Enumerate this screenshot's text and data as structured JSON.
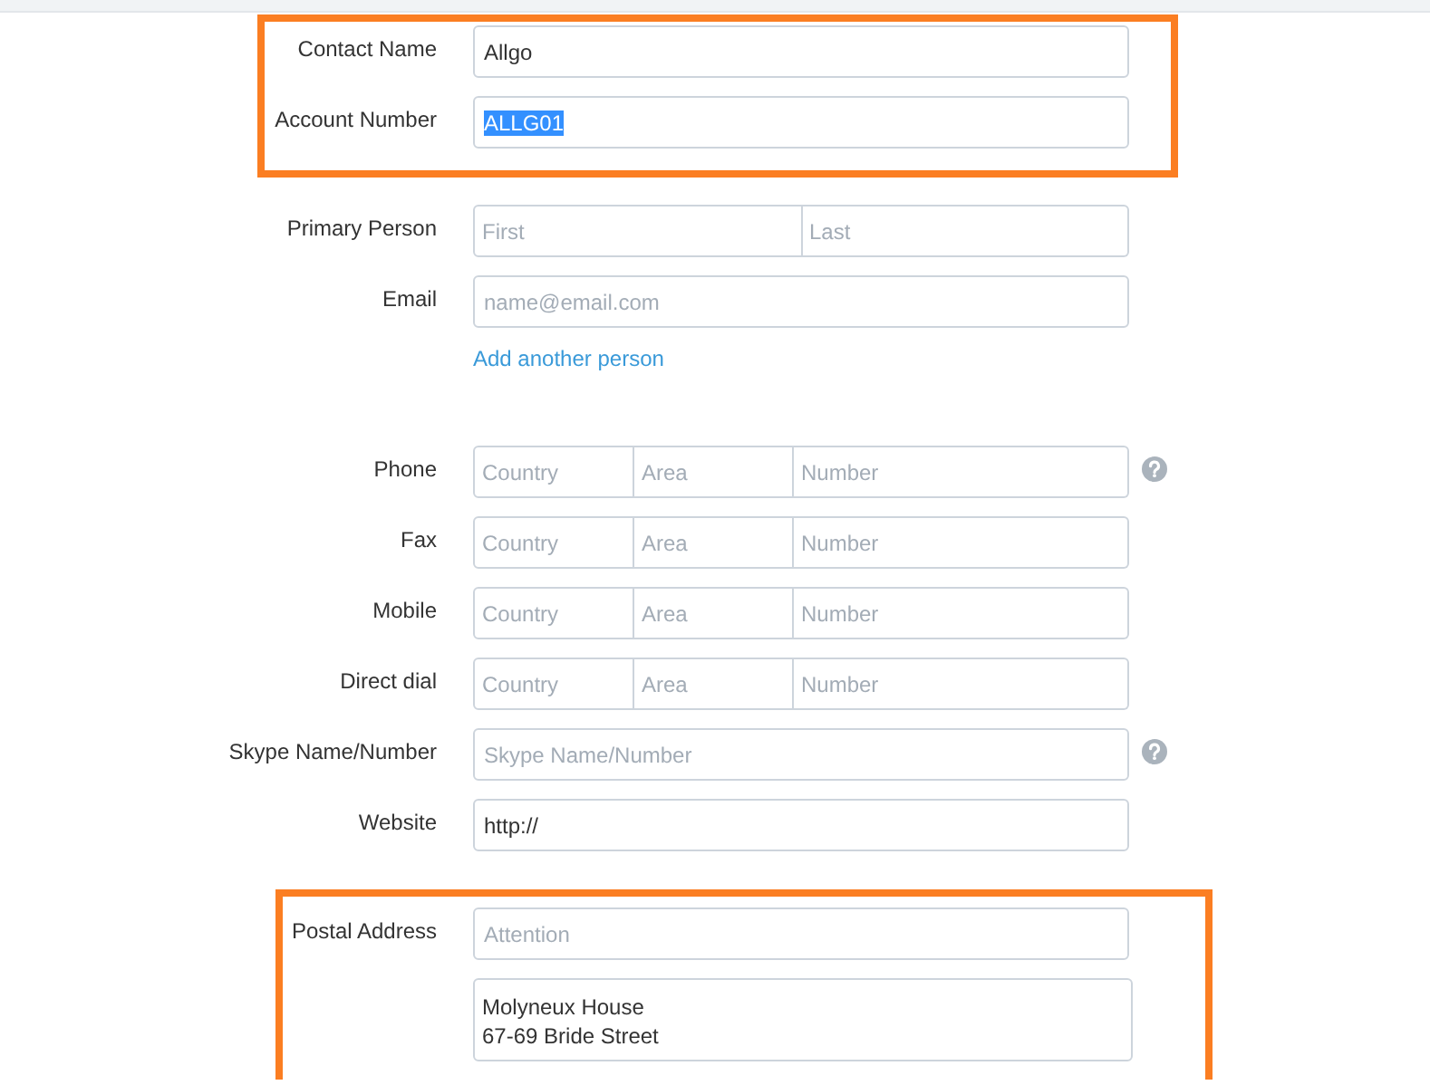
{
  "sections": [
    {
      "highlighted": true,
      "rows": [
        {
          "label": "Contact Name",
          "kind": "text",
          "value": "Allgo"
        },
        {
          "label": "Account Number",
          "kind": "text",
          "value": "ALLG01",
          "text_selected": true
        }
      ]
    },
    {
      "highlighted": false,
      "rows": [
        {
          "label": "Primary Person",
          "kind": "split",
          "parts": [
            {
              "placeholder": "First"
            },
            {
              "placeholder": "Last"
            }
          ]
        },
        {
          "label": "Email",
          "kind": "text",
          "placeholder": "name@email.com"
        },
        {
          "kind": "link",
          "text": "Add another person"
        }
      ]
    },
    {
      "highlighted": false,
      "rows": [
        {
          "label": "Phone",
          "kind": "split",
          "help": true,
          "parts": [
            {
              "placeholder": "Country"
            },
            {
              "placeholder": "Area"
            },
            {
              "placeholder": "Number"
            }
          ]
        },
        {
          "label": "Fax",
          "kind": "split",
          "parts": [
            {
              "placeholder": "Country"
            },
            {
              "placeholder": "Area"
            },
            {
              "placeholder": "Number"
            }
          ]
        },
        {
          "label": "Mobile",
          "kind": "split",
          "parts": [
            {
              "placeholder": "Country"
            },
            {
              "placeholder": "Area"
            },
            {
              "placeholder": "Number"
            }
          ]
        },
        {
          "label": "Direct dial",
          "kind": "split",
          "parts": [
            {
              "placeholder": "Country"
            },
            {
              "placeholder": "Area"
            },
            {
              "placeholder": "Number"
            }
          ]
        },
        {
          "label": "Skype Name/Number",
          "kind": "text",
          "help": true,
          "placeholder": "Skype Name/Number"
        },
        {
          "label": "Website",
          "kind": "text",
          "value": "http://"
        }
      ]
    },
    {
      "highlighted": true,
      "rows": [
        {
          "label": "Postal Address",
          "kind": "text",
          "placeholder": "Attention"
        },
        {
          "kind": "textarea",
          "lines": [
            "Molyneux House",
            "67-69 Bride Street"
          ]
        }
      ]
    }
  ]
}
